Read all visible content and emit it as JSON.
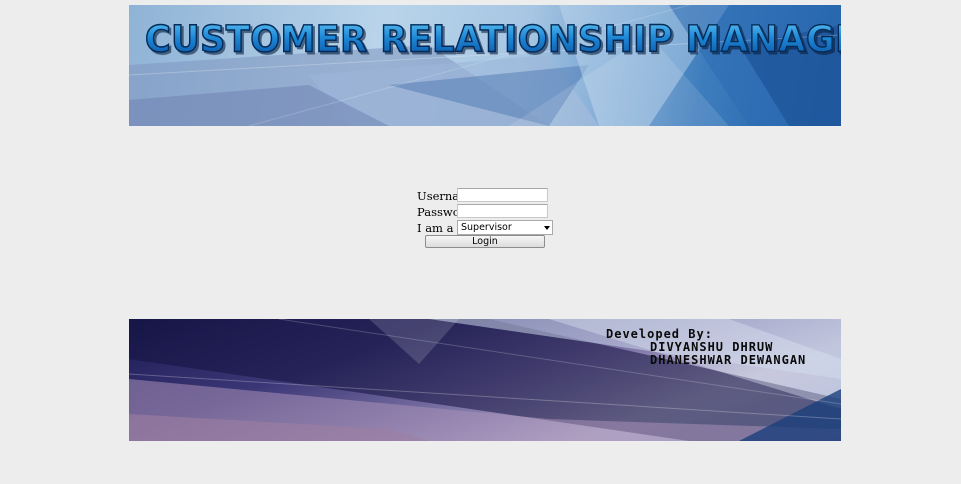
{
  "header": {
    "title": "CUSTOMER RELATIONSHIP MANAGEMENT"
  },
  "login": {
    "username_label": "Username",
    "username_value": "",
    "password_label": "Password",
    "password_value": "",
    "role_label": "I am a",
    "role_selected": "Supervisor",
    "submit_label": "Login"
  },
  "footer": {
    "heading": "Developed By:",
    "developers": [
      "DIVYANSHU DHRUW",
      "DHANESHWAR DEWANGAN"
    ]
  },
  "colors": {
    "page_background": "#ededed",
    "title_blue": "#0b6fc2",
    "footer_dark": "#1a1a52"
  }
}
